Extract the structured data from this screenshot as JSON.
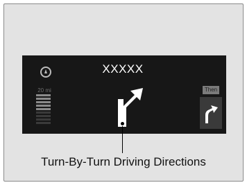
{
  "display": {
    "street_name": "XXXXX",
    "distance_label": "20 mi",
    "then_label": "Then",
    "main_arrow_icon": "turn-right-arrow-icon",
    "next_arrow_icon": "turn-right-arrow-icon",
    "compass_icon": "compass-icon"
  },
  "meter": {
    "filled_bars": 5,
    "total_bars": 9
  },
  "caption": "Turn-By-Turn Driving Directions",
  "colors": {
    "display_bg": "#171717",
    "frame_bg": "#e3e3e3",
    "arrow": "#ffffff"
  }
}
